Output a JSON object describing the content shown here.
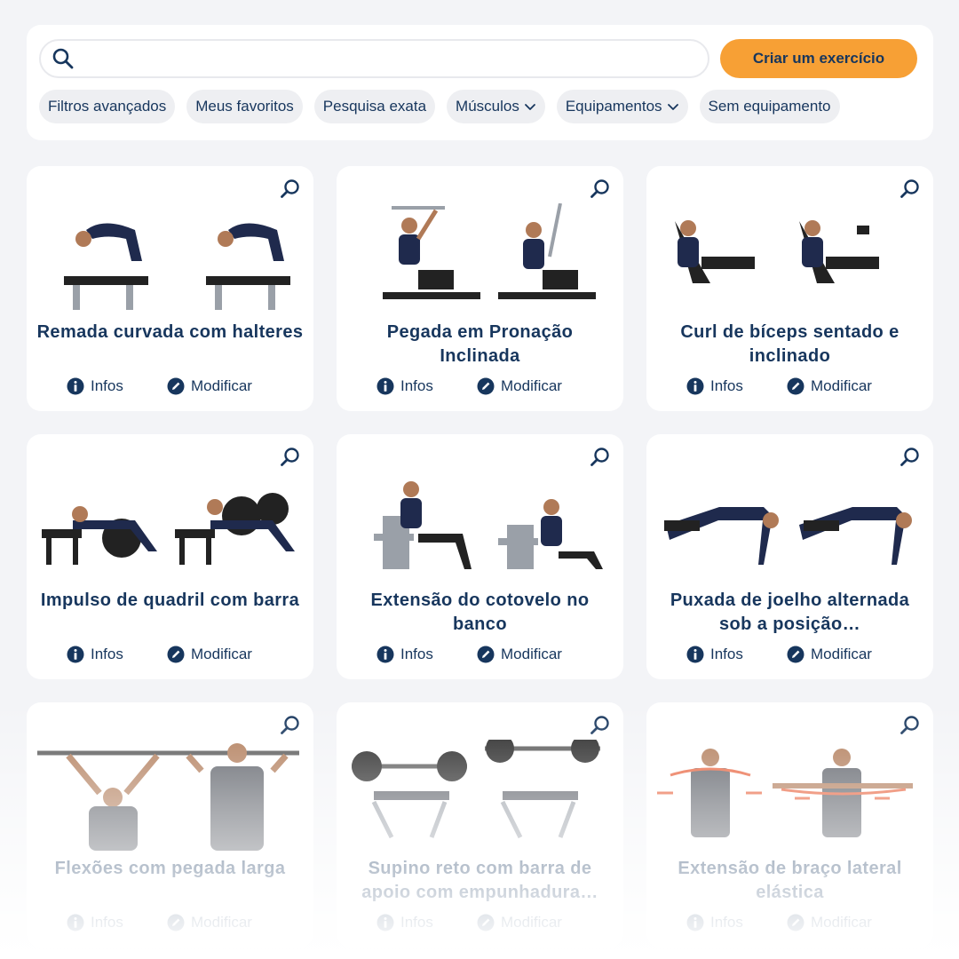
{
  "search": {
    "value": "",
    "placeholder": ""
  },
  "toolbar": {
    "create_label": "Criar um exercício"
  },
  "filters": [
    {
      "label": "Filtros avançados",
      "dropdown": false
    },
    {
      "label": "Meus favoritos",
      "dropdown": false
    },
    {
      "label": "Pesquisa exata",
      "dropdown": false
    },
    {
      "label": "Músculos",
      "dropdown": true
    },
    {
      "label": "Equipamentos",
      "dropdown": true
    },
    {
      "label": "Sem equipamento",
      "dropdown": false
    }
  ],
  "actions": {
    "info_label": "Infos",
    "edit_label": "Modificar"
  },
  "exercises": [
    {
      "title": "Remada curvada com halteres",
      "illustration": "bent-over-dumbbell-row"
    },
    {
      "title": "Pegada em Pronação Inclinada",
      "illustration": "incline-pronated-grip"
    },
    {
      "title": "Curl de bíceps sentado e inclinado",
      "illustration": "incline-seated-biceps-curl"
    },
    {
      "title": "Impulso de quadril com barra",
      "illustration": "barbell-hip-thrust"
    },
    {
      "title": "Extensão do cotovelo no banco",
      "illustration": "bench-dips"
    },
    {
      "title": "Puxada de joelho alternada sob a posição…",
      "illustration": "alternating-knee-drive-plank"
    },
    {
      "title": "Flexões com pegada larga",
      "illustration": "wide-grip-pull-up"
    },
    {
      "title": "Supino reto com barra de apoio com empunhadura…",
      "illustration": "barbell-bench-press"
    },
    {
      "title": "Extensão de braço lateral elástica",
      "illustration": "band-lateral-arm-extension"
    }
  ],
  "colors": {
    "accent": "#f7a035",
    "text": "#17365d",
    "background": "#f3f4f7",
    "chip": "#eeeff2",
    "band": "#e8603a"
  }
}
